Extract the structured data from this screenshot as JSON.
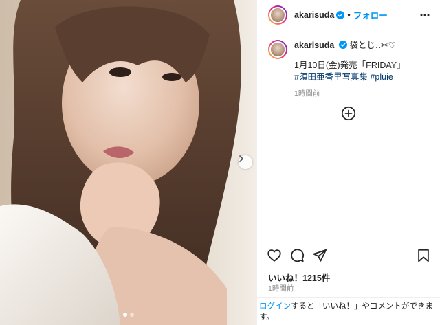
{
  "photo": {
    "alt": "",
    "carousel": {
      "count": 2,
      "current": 1
    }
  },
  "account": {
    "username": "akarisuda",
    "separator": "•",
    "follow_label": "フォロー"
  },
  "caption": {
    "username": "akarisuda",
    "line1": "袋とじ‥✂︎♡",
    "line2": "1月10日(金)発売「FRIDAY」",
    "hashtag1": "#須田亜香里写真集",
    "hashtag2": "#pluie",
    "time": "1時間前"
  },
  "engagement": {
    "likes": "いいね！1215件",
    "time": "1時間前"
  },
  "login_prompt": {
    "link": "ログイン",
    "text": "すると「いいね！」やコメントができます。"
  },
  "icons": {
    "more": "more-horizontal-icon",
    "verified": "verified-badge-icon",
    "load_more": "plus-circle-icon",
    "like": "heart-icon",
    "comment": "comment-bubble-icon",
    "share": "paper-plane-icon",
    "save": "bookmark-icon",
    "next": "chevron-right-icon"
  },
  "colors": {
    "link_blue": "#0095f6",
    "hashtag": "#00376b",
    "meta_gray": "#8e8e8e",
    "text": "#262626"
  }
}
